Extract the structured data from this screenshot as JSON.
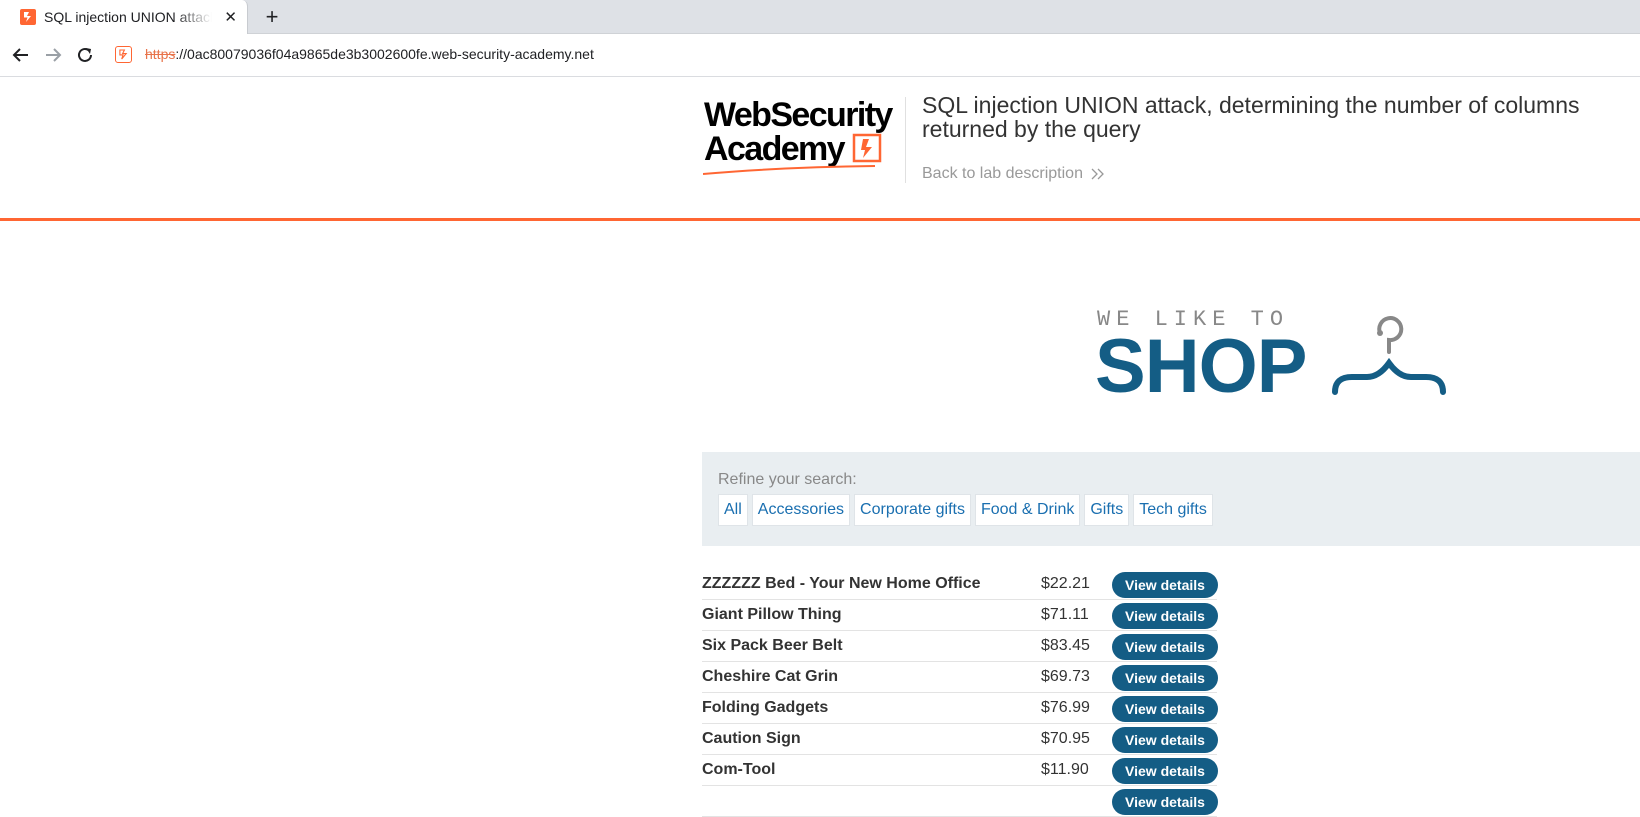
{
  "browser": {
    "tab_title": "SQL injection UNION attack, determining the number of columns returned by the query",
    "url_scheme": "https",
    "url_rest": "://0ac80079036f04a9865de3b3002600fe.web-security-academy.net"
  },
  "header": {
    "logo_line1": "WebSecurity",
    "logo_line2": "Academy",
    "lab_title": "SQL injection UNION attack, determining the number of columns returned by the query",
    "back_link": "Back to lab description"
  },
  "banner": {
    "small_text": "WE LIKE TO",
    "big_text": "SHOP"
  },
  "filters": {
    "label": "Refine your search:",
    "items": [
      "All",
      "Accessories",
      "Corporate gifts",
      "Food & Drink",
      "Gifts",
      "Tech gifts"
    ]
  },
  "products": [
    {
      "name": "ZZZZZZ Bed - Your New Home Office",
      "price": "$22.21",
      "button": "View details"
    },
    {
      "name": "Giant Pillow Thing",
      "price": "$71.11",
      "button": "View details"
    },
    {
      "name": "Six Pack Beer Belt",
      "price": "$83.45",
      "button": "View details"
    },
    {
      "name": "Cheshire Cat Grin",
      "price": "$69.73",
      "button": "View details"
    },
    {
      "name": "Folding Gadgets",
      "price": "$76.99",
      "button": "View details"
    },
    {
      "name": "Caution Sign",
      "price": "$70.95",
      "button": "View details"
    },
    {
      "name": "Com-Tool",
      "price": "$11.90",
      "button": "View details"
    },
    {
      "name": "",
      "price": "",
      "button": "View details"
    }
  ],
  "colors": {
    "accent": "#ff6633",
    "brand_blue": "#145d85",
    "link": "#1a6fb0",
    "filter_bg": "#e9eef1"
  }
}
